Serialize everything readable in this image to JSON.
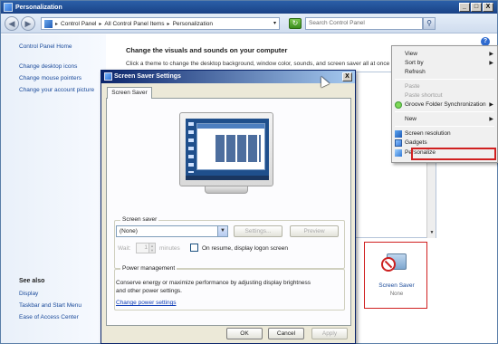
{
  "window": {
    "title": "Personalization",
    "controls": [
      "_",
      "□",
      "X"
    ]
  },
  "address_bar": {
    "path": [
      "Control Panel",
      "All Control Panel Items",
      "Personalization"
    ],
    "search_placeholder": "Search Control Panel"
  },
  "left_pane": {
    "links": [
      "Control Panel Home",
      "Change desktop icons",
      "Change mouse pointers",
      "Change your account picture"
    ],
    "see_also_heading": "See also",
    "see_also": [
      "Display",
      "Taskbar and Start Menu",
      "Ease of Access Center"
    ]
  },
  "main": {
    "title": "Change the visuals and sounds on your computer",
    "description": "Click a theme to change the desktop background, window color, sounds, and screen saver all at once"
  },
  "screen_saver_tile": {
    "label": "Screen Saver",
    "value": "None"
  },
  "context_menu": {
    "items": [
      {
        "label": "View",
        "submenu": true,
        "disabled": false
      },
      {
        "label": "Sort by",
        "submenu": true,
        "disabled": false
      },
      {
        "label": "Refresh",
        "submenu": false,
        "disabled": false
      },
      {
        "label": "Paste",
        "submenu": false,
        "disabled": true
      },
      {
        "label": "Paste shortcut",
        "submenu": false,
        "disabled": true
      },
      {
        "label": "Groove Folder Synchronization",
        "submenu": true,
        "disabled": false,
        "icon": "groove-icon"
      },
      {
        "label": "New",
        "submenu": true,
        "disabled": false
      },
      {
        "label": "Screen resolution",
        "submenu": false,
        "disabled": false,
        "icon": "screen-resolution-icon"
      },
      {
        "label": "Gadgets",
        "submenu": false,
        "disabled": false,
        "icon": "gadgets-icon"
      },
      {
        "label": "Personalize",
        "submenu": false,
        "disabled": false,
        "icon": "personalize-icon",
        "highlighted": true
      }
    ]
  },
  "dialog": {
    "title": "Screen Saver Settings",
    "close": "X",
    "tab": "Screen Saver",
    "screen_saver_group": "Screen saver",
    "selected_saver": "(None)",
    "settings_button": "Settings...",
    "preview_button": "Preview",
    "wait_label": "Wait:",
    "wait_value": "1",
    "minutes_label": "minutes",
    "resume_label": "On resume, display logon screen",
    "power_group": "Power management",
    "power_text": "Conserve energy or maximize performance by adjusting display brightness and other power settings.",
    "power_link": "Change power settings",
    "ok": "OK",
    "cancel": "Cancel",
    "apply": "Apply"
  },
  "colors": {
    "title_bar": "#1a4286",
    "link": "#1a4a9a",
    "highlight_border": "#d02020",
    "dialog_bg": "#ece9d8"
  }
}
